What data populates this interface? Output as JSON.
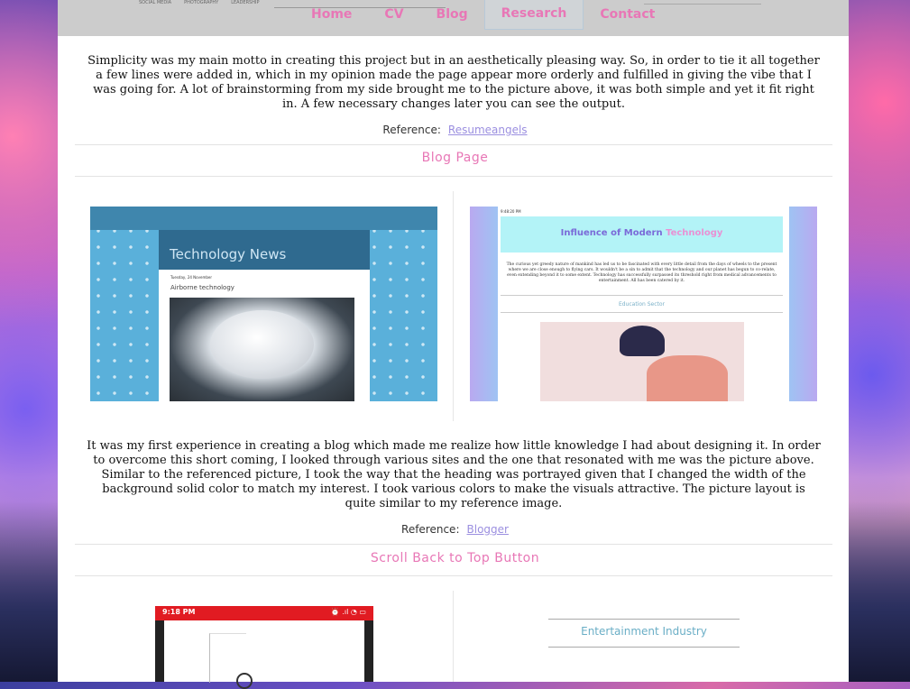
{
  "nav": {
    "ghost": [
      "SOCIAL MEDIA",
      "PHOTOGRAPHY",
      "LEADERSHIP"
    ],
    "links": [
      "Home",
      "CV",
      "Blog",
      "Research",
      "Contact"
    ],
    "active": "Research"
  },
  "section1": {
    "paragraph": "Simplicity was my main motto in creating this project but in an aesthetically pleasing way. So, in order to tie it all together a few lines were added in, which in my opinion made the page appear more orderly and fulfilled in giving the vibe that I was going for. A lot of brainstorming from my side brought me to the picture above, it was both simple and yet it fit right in. A few necessary changes later you can see the output.",
    "reference_label": "Reference:",
    "reference_link": "Resumeangels"
  },
  "blog": {
    "title": "Blog Page",
    "shot_left": {
      "header": "Technology News",
      "date": "Tuesday, 24 November",
      "post_title": "Airborne technology"
    },
    "shot_right": {
      "time": "9:48:20 PM",
      "banner_main": "Influence of Modern ",
      "banner_highlight": "Technology",
      "body": "The curious yet greedy nature of mankind has led us to be fascinated with every little detail from the days of wheels to the present where we are close enough to flying cars. It wouldn't be a sin to admit that the technology and our planet has begun to co-relate, even extending beyond it to some extent. Technology has successfully surpassed its threshold right from medical advancements to entertainment. All has been catered by it.",
      "sector": "Education Sector"
    },
    "paragraph": "It was my first experience in creating a blog which made me realize how little knowledge I had about designing it. In order to overcome this short coming, I looked through various sites and the one that resonated with me was the picture above. Similar to the referenced picture, I took the way that the heading was portrayed given that I changed the width of the background solid color to match my interest. I took various colors to make the visuals attractive. The picture layout is quite similar to my reference image.",
    "reference_label": "Reference:",
    "reference_link": "Blogger"
  },
  "scroll": {
    "title": "Scroll Back to Top Button",
    "phone_time": "9:18 PM",
    "phone_icons": "⏰ .ıl ◔ ▭",
    "entertainment": "Entertainment Industry"
  }
}
